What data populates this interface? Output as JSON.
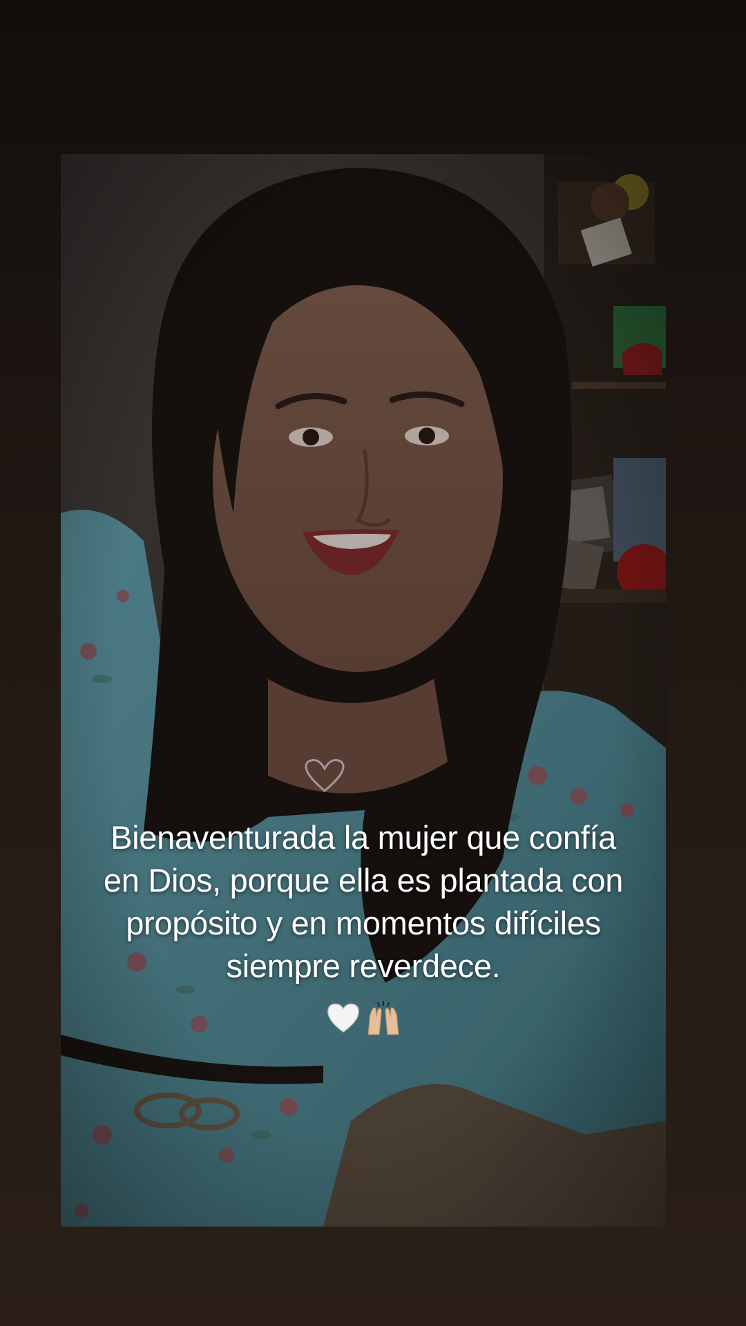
{
  "story": {
    "caption_lines": [
      "Bienaventurada la mujer que confía",
      "en Dios, porque ella es plantada con",
      "propósito y en momentos difíciles",
      "siempre reverdece."
    ],
    "emojis": [
      {
        "name": "white-heart-icon",
        "glyph": "🤍"
      },
      {
        "name": "raising-hands-icon",
        "glyph": "🙌🏼"
      }
    ]
  },
  "colors": {
    "background_top": "#110e0c",
    "background_bottom": "#2b1f18",
    "caption_text": "#ffffff",
    "dress": "#6fa9b3",
    "hair": "#1a1412"
  }
}
